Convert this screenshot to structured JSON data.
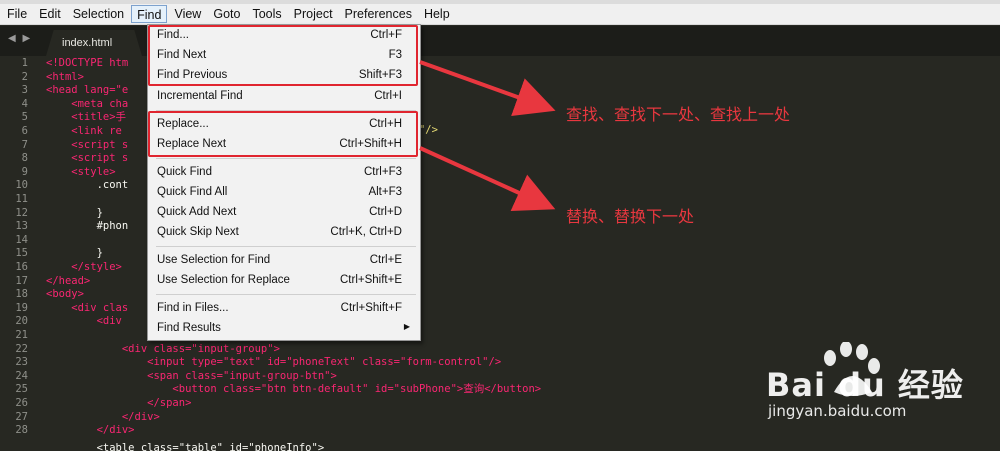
{
  "menubar": {
    "items": [
      "File",
      "Edit",
      "Selection",
      "Find",
      "View",
      "Goto",
      "Tools",
      "Project",
      "Preferences",
      "Help"
    ],
    "active": "Find"
  },
  "tab": {
    "label": "index.html",
    "nav_arrows": "◀ ▶"
  },
  "editor": {
    "line_numbers": [
      "1",
      "2",
      "3",
      "4",
      "5",
      "6",
      "7",
      "8",
      "9",
      "10",
      "11",
      "12",
      "13",
      "14",
      "15",
      "16",
      "17",
      "18",
      "19",
      "20",
      "21",
      "22",
      "23",
      "24",
      "25",
      "26",
      "27",
      "28"
    ],
    "lines": [
      "<!DOCTYPE htm",
      "<html>",
      "<head lang=\"e",
      "    <meta cha",
      "    <title>手",
      "    <link re",
      "    <script s",
      "    <script s",
      "    <style>",
      "        .cont",
      "",
      "        }",
      "        #phon",
      "",
      "        }",
      "    </style>",
      "</head>",
      "<body>",
      "    <div clas",
      "        <div",
      "",
      "            <div class=\"input-group\">",
      "                <input type=\"text\" id=\"phoneText\" class=\"form-control\"/>",
      "                <span class=\"input-group-btn\">",
      "                    <button class=\"btn btn-default\" id=\"subPhone\">查询</button>",
      "                </span>",
      "            </div>",
      "        </div>"
    ],
    "right_fragment": "css\"/>",
    "partial_last_line": "        <table class=\"table\" id=\"phoneInfo\">"
  },
  "find_menu": {
    "items": [
      {
        "label": "Find...",
        "shortcut": "Ctrl+F"
      },
      {
        "label": "Find Next",
        "shortcut": "F3"
      },
      {
        "label": "Find Previous",
        "shortcut": "Shift+F3"
      },
      {
        "label": "Incremental Find",
        "shortcut": "Ctrl+I"
      },
      {
        "label": "Replace...",
        "shortcut": "Ctrl+H"
      },
      {
        "label": "Replace Next",
        "shortcut": "Ctrl+Shift+H"
      },
      {
        "label": "Quick Find",
        "shortcut": "Ctrl+F3"
      },
      {
        "label": "Quick Find All",
        "shortcut": "Alt+F3"
      },
      {
        "label": "Quick Add Next",
        "shortcut": "Ctrl+D"
      },
      {
        "label": "Quick Skip Next",
        "shortcut": "Ctrl+K, Ctrl+D"
      },
      {
        "label": "Use Selection for Find",
        "shortcut": "Ctrl+E"
      },
      {
        "label": "Use Selection for Replace",
        "shortcut": "Ctrl+Shift+E"
      },
      {
        "label": "Find in Files...",
        "shortcut": "Ctrl+Shift+F"
      },
      {
        "label": "Find Results",
        "shortcut": ""
      }
    ],
    "submenu_arrow": "▶"
  },
  "annotations": {
    "find_note": "查找、查找下一处、查找上一处",
    "replace_note": "替换、替换下一处"
  },
  "watermark": {
    "brand": "Bai du 经验",
    "url": "jingyan.baidu.com"
  },
  "colors": {
    "editor_bg": "#272822",
    "highlight_red": "#e0252f",
    "annotation_red": "#e8373f",
    "tag_pink": "#f92672",
    "attr_green": "#a6e22e",
    "string_yellow": "#e6db74"
  }
}
